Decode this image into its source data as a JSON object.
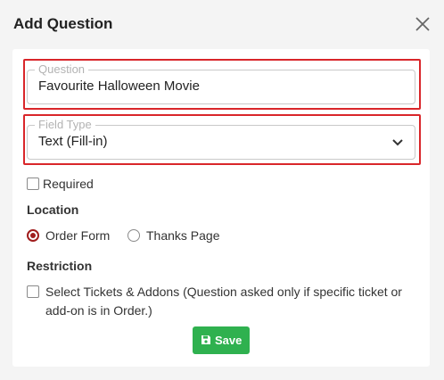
{
  "modal": {
    "title": "Add Question"
  },
  "question": {
    "legend": "Question",
    "value": "Favourite Halloween Movie"
  },
  "field_type": {
    "legend": "Field Type",
    "selected": "Text (Fill-in)"
  },
  "required": {
    "label": "Required",
    "checked": false
  },
  "location": {
    "heading": "Location",
    "options": [
      {
        "label": "Order Form",
        "selected": true
      },
      {
        "label": "Thanks Page",
        "selected": false
      }
    ]
  },
  "restriction": {
    "heading": "Restriction",
    "line1": "Select Tickets & Addons (Question asked only if specific ticket or",
    "line2": "add-on is in Order.)",
    "checked": false
  },
  "save_button": {
    "label": "Save"
  },
  "colors": {
    "highlight": "#d9262a",
    "radio_selected": "#a01d1d",
    "save_bg": "#2fb14f"
  },
  "icons": {
    "close": "close-icon",
    "dropdown": "chevron-down-icon",
    "save": "floppy-disk-icon"
  }
}
